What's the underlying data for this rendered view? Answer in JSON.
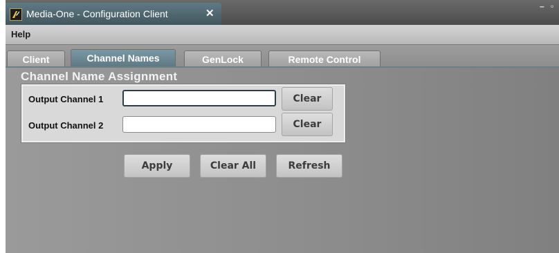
{
  "window": {
    "title": "Media-One - Configuration Client",
    "close_glyph": "✕",
    "minimize_glyph": "–",
    "maximize_glyph": "▫"
  },
  "menu": {
    "help": "Help"
  },
  "tabs": [
    {
      "label": "Client",
      "active": false
    },
    {
      "label": "Channel Names",
      "active": true
    },
    {
      "label": "GenLock",
      "active": false
    },
    {
      "label": "Remote Control",
      "active": false
    }
  ],
  "panel": {
    "title": "Channel Name Assignment",
    "channels": [
      {
        "label": "Output Channel 1",
        "value": "",
        "clear_label": "Clear"
      },
      {
        "label": "Output Channel 2",
        "value": "",
        "clear_label": "Clear"
      }
    ],
    "buttons": {
      "apply": "Apply",
      "clear_all": "Clear All",
      "refresh": "Refresh"
    }
  },
  "icons": {
    "app": "media-one-logo-icon",
    "close": "close-icon"
  },
  "colors": {
    "active_tab": "#6b8792",
    "content_bg": "#8c8c8c"
  }
}
